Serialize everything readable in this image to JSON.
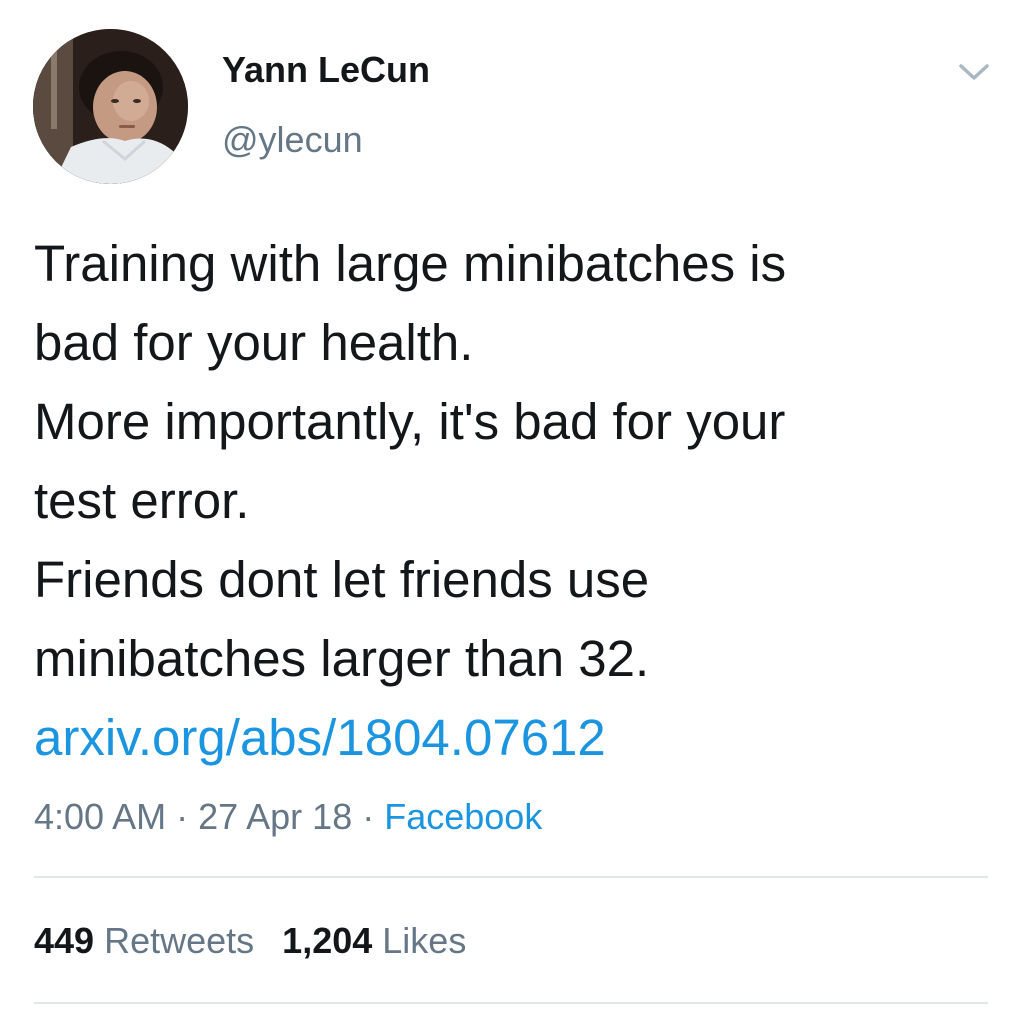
{
  "author": {
    "display_name": "Yann LeCun",
    "handle": "@ylecun"
  },
  "tweet": {
    "lines": [
      "Training with large minibatches is",
      "bad for your health.",
      "More importantly, it's bad for your",
      "test error.",
      "Friends dont let friends use",
      "minibatches larger than 32."
    ],
    "link_text": "arxiv.org/abs/1804.07612"
  },
  "meta": {
    "time": "4:00 AM",
    "separator": "·",
    "date": "27 Apr 18",
    "source": "Facebook"
  },
  "stats": {
    "retweets_count": "449",
    "retweets_label": "Retweets",
    "likes_count": "1,204",
    "likes_label": "Likes"
  },
  "icons": {
    "menu": "chevron-down-icon"
  },
  "colors": {
    "text": "#14171a",
    "secondary": "#657786",
    "link": "#1b95e0",
    "divider": "#e1e8ed"
  }
}
